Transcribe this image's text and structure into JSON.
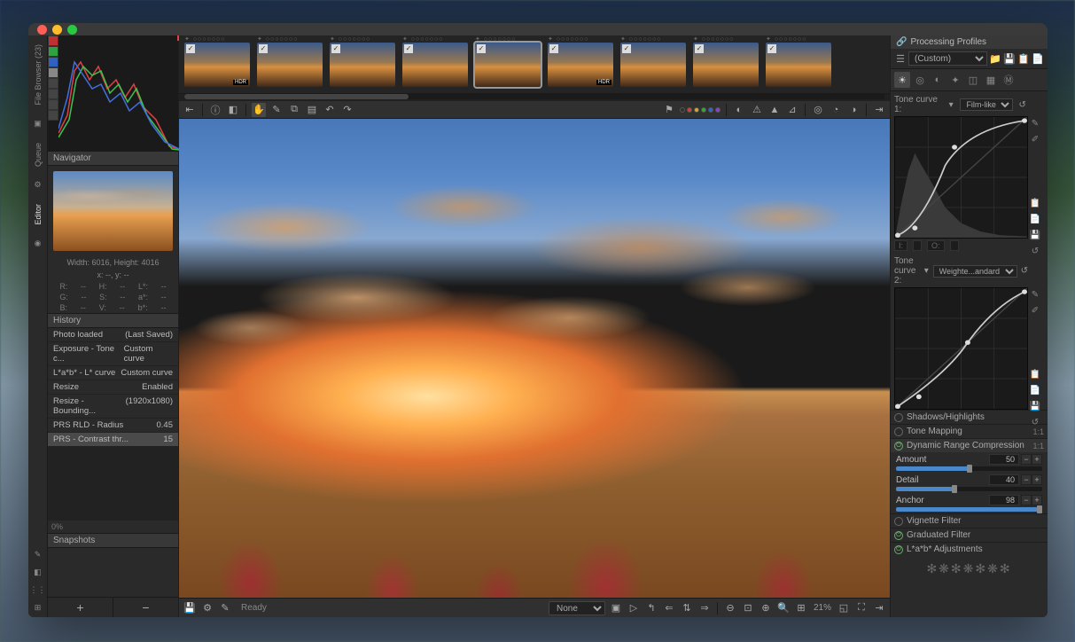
{
  "vtabs": {
    "file_browser": "File Browser (23)",
    "queue": "Queue",
    "editor": "Editor"
  },
  "navigator": {
    "title": "Navigator",
    "dims": "Width: 6016, Height: 4016",
    "xy": "x: --, y: --",
    "r": "R:",
    "g": "G:",
    "b": "B:",
    "h": "H:",
    "s": "S:",
    "v": "V:",
    "L": "L*:",
    "a": "a*:",
    "b2": "b*:",
    "dash": "--"
  },
  "history": {
    "title": "History",
    "items": [
      {
        "l": "Photo loaded",
        "r": "(Last Saved)"
      },
      {
        "l": "Exposure - Tone c...",
        "r": "Custom curve"
      },
      {
        "l": "L*a*b* - L* curve",
        "r": "Custom curve"
      },
      {
        "l": "Resize",
        "r": "Enabled"
      },
      {
        "l": "Resize - Bounding...",
        "r": "(1920x1080)"
      },
      {
        "l": "PRS RLD - Radius",
        "r": "0.45"
      },
      {
        "l": "PRS - Contrast thr...",
        "r": "15"
      }
    ]
  },
  "snapshots": {
    "title": "Snapshots",
    "plus": "+",
    "minus": "−",
    "pct": "0%"
  },
  "status": {
    "ready": "Ready",
    "select_none": "None",
    "zoom": "21%"
  },
  "processing_profiles": {
    "title": "Processing Profiles",
    "custom": "(Custom)"
  },
  "tone_curve": {
    "t1_label": "Tone curve 1:",
    "t1_type": "Film-like",
    "t2_label": "Tone curve 2:",
    "t2_type": "Weighte...andard",
    "in_label": "I:",
    "out_label": "O:",
    "in_val": "",
    "out_val": ""
  },
  "sections": {
    "shadows": "Shadows/Highlights",
    "tonemap": "Tone Mapping",
    "drc": "Dynamic Range Compression",
    "vignette": "Vignette Filter",
    "graduated": "Graduated Filter",
    "lab": "L*a*b* Adjustments",
    "ratio": "1:1"
  },
  "drc_params": {
    "amount": {
      "label": "Amount",
      "value": "50"
    },
    "detail": {
      "label": "Detail",
      "value": "40"
    },
    "anchor": {
      "label": "Anchor",
      "value": "98"
    }
  },
  "icons": {
    "folder": "📁",
    "gear": "⚙",
    "aperture": "◉"
  }
}
